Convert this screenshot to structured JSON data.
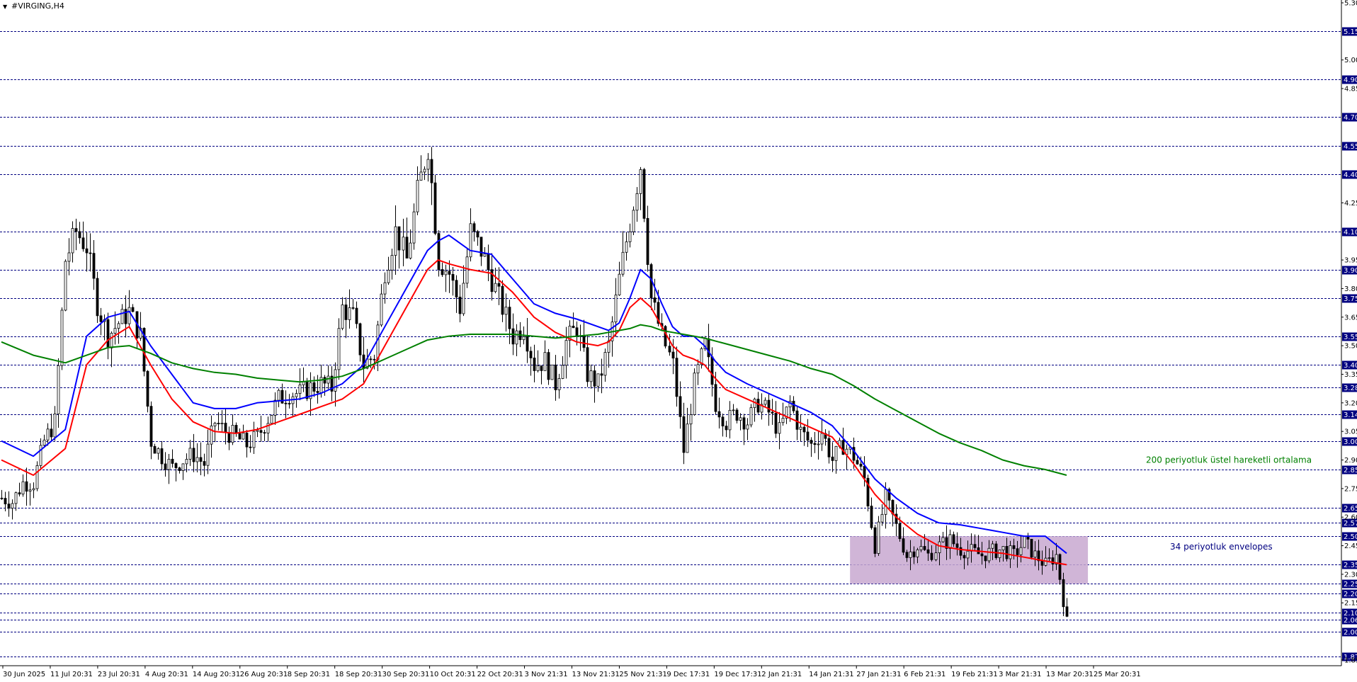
{
  "window": {
    "symbol_title": "#VIRGING,H4",
    "menu_glyph": "▼"
  },
  "colors": {
    "ema_blue": "#0000ff",
    "ema_red": "#ff0000",
    "ema_green": "#008000",
    "candle": "#000000",
    "price_tag_bg": "#000080",
    "hline": "#000080",
    "envelope_box": "#c8a8d0"
  },
  "chart_data": {
    "type": "candlestick",
    "symbol": "#VIRGING,H4",
    "ylim": [
      1.82,
      5.3
    ],
    "y_ticks": [
      "5.30",
      "5.00",
      "4.85",
      "4.25",
      "3.95",
      "3.80",
      "3.65",
      "3.50",
      "3.35",
      "3.20",
      "3.05",
      "2.90",
      "2.75",
      "2.60",
      "2.45",
      "2.30",
      "2.15",
      "1.85"
    ],
    "price_lines": [
      "5.15",
      "4.90",
      "4.70",
      "4.55",
      "4.40",
      "4.10",
      "3.90",
      "3.75",
      "3.55",
      "3.40",
      "3.28",
      "3.14",
      "3.00",
      "2.85",
      "2.65",
      "2.57",
      "2.50",
      "2.35",
      "2.25",
      "2.20",
      "2.10",
      "2.06",
      "2.00",
      "1.87"
    ],
    "x_labels": [
      "30 Jun 2025",
      "11 Jul 20:31",
      "23 Jul 20:31",
      "4 Aug 20:31",
      "14 Aug 20:31",
      "26 Aug 20:31",
      "8 Sep 20:31",
      "18 Sep 20:31",
      "30 Sep 20:31",
      "10 Oct 20:31",
      "22 Oct 20:31",
      "3 Nov 21:31",
      "13 Nov 21:31",
      "25 Nov 21:31",
      "9 Dec 17:31",
      "19 Dec 17:31",
      "2 Jan 21:31",
      "14 Jan 21:31",
      "27 Jan 21:31",
      "6 Feb 21:31",
      "19 Feb 21:31",
      "3 Mar 21:31",
      "13 Mar 20:31",
      "25 Mar 20:31"
    ],
    "price_path": [
      [
        0,
        2.7
      ],
      [
        15,
        2.68
      ],
      [
        30,
        2.78
      ],
      [
        45,
        2.78
      ],
      [
        60,
        3.0
      ],
      [
        75,
        3.1
      ],
      [
        90,
        3.95
      ],
      [
        105,
        4.1
      ],
      [
        120,
        4.02
      ],
      [
        135,
        3.72
      ],
      [
        150,
        3.55
      ],
      [
        165,
        3.62
      ],
      [
        180,
        3.68
      ],
      [
        195,
        3.55
      ],
      [
        210,
        3.0
      ],
      [
        225,
        2.92
      ],
      [
        240,
        2.86
      ],
      [
        255,
        2.9
      ],
      [
        270,
        2.93
      ],
      [
        285,
        2.88
      ],
      [
        300,
        3.1
      ],
      [
        315,
        3.05
      ],
      [
        330,
        3.02
      ],
      [
        345,
        2.98
      ],
      [
        360,
        3.02
      ],
      [
        375,
        3.12
      ],
      [
        390,
        3.22
      ],
      [
        405,
        3.25
      ],
      [
        420,
        3.25
      ],
      [
        435,
        3.28
      ],
      [
        450,
        3.3
      ],
      [
        465,
        3.28
      ],
      [
        480,
        3.7
      ],
      [
        495,
        3.65
      ],
      [
        510,
        3.4
      ],
      [
        525,
        3.45
      ],
      [
        540,
        3.9
      ],
      [
        555,
        4.1
      ],
      [
        570,
        3.95
      ],
      [
        585,
        4.3
      ],
      [
        600,
        4.55
      ],
      [
        615,
        3.95
      ],
      [
        630,
        3.88
      ],
      [
        645,
        3.7
      ],
      [
        660,
        4.1
      ],
      [
        675,
        4.0
      ],
      [
        690,
        3.85
      ],
      [
        705,
        3.7
      ],
      [
        720,
        3.55
      ],
      [
        735,
        3.6
      ],
      [
        750,
        3.4
      ],
      [
        765,
        3.42
      ],
      [
        780,
        3.3
      ],
      [
        795,
        3.52
      ],
      [
        810,
        3.6
      ],
      [
        825,
        3.35
      ],
      [
        840,
        3.3
      ],
      [
        855,
        3.5
      ],
      [
        870,
        3.85
      ],
      [
        885,
        4.15
      ],
      [
        900,
        4.45
      ],
      [
        915,
        3.75
      ],
      [
        930,
        3.55
      ],
      [
        945,
        3.4
      ],
      [
        960,
        2.95
      ],
      [
        975,
        3.3
      ],
      [
        990,
        3.5
      ],
      [
        1005,
        3.2
      ],
      [
        1020,
        3.1
      ],
      [
        1035,
        3.15
      ],
      [
        1050,
        3.1
      ],
      [
        1065,
        3.2
      ],
      [
        1080,
        3.15
      ],
      [
        1095,
        3.05
      ],
      [
        1110,
        3.2
      ],
      [
        1125,
        3.05
      ],
      [
        1140,
        2.98
      ],
      [
        1155,
        3.05
      ],
      [
        1170,
        2.9
      ],
      [
        1185,
        2.98
      ],
      [
        1200,
        2.92
      ],
      [
        1215,
        2.8
      ],
      [
        1230,
        2.45
      ],
      [
        1245,
        2.7
      ],
      [
        1260,
        2.55
      ],
      [
        1275,
        2.4
      ],
      [
        1290,
        2.45
      ],
      [
        1305,
        2.4
      ],
      [
        1320,
        2.45
      ],
      [
        1335,
        2.48
      ],
      [
        1350,
        2.43
      ],
      [
        1365,
        2.42
      ],
      [
        1380,
        2.4
      ],
      [
        1395,
        2.42
      ],
      [
        1410,
        2.43
      ],
      [
        1425,
        2.4
      ],
      [
        1440,
        2.47
      ],
      [
        1455,
        2.4
      ],
      [
        1470,
        2.35
      ],
      [
        1485,
        2.4
      ],
      [
        1500,
        2.05
      ]
    ],
    "series": [
      {
        "name": "",
        "color": "#0000ff",
        "type": "ema",
        "points": [
          [
            0,
            3.0
          ],
          [
            45,
            2.92
          ],
          [
            90,
            3.06
          ],
          [
            120,
            3.55
          ],
          [
            150,
            3.65
          ],
          [
            180,
            3.68
          ],
          [
            210,
            3.5
          ],
          [
            240,
            3.35
          ],
          [
            270,
            3.2
          ],
          [
            300,
            3.17
          ],
          [
            330,
            3.17
          ],
          [
            360,
            3.2
          ],
          [
            390,
            3.21
          ],
          [
            420,
            3.22
          ],
          [
            450,
            3.25
          ],
          [
            480,
            3.3
          ],
          [
            510,
            3.4
          ],
          [
            540,
            3.6
          ],
          [
            570,
            3.8
          ],
          [
            600,
            4.0
          ],
          [
            615,
            4.05
          ],
          [
            630,
            4.08
          ],
          [
            660,
            4.0
          ],
          [
            690,
            3.98
          ],
          [
            720,
            3.85
          ],
          [
            750,
            3.72
          ],
          [
            780,
            3.67
          ],
          [
            810,
            3.64
          ],
          [
            840,
            3.6
          ],
          [
            855,
            3.58
          ],
          [
            870,
            3.62
          ],
          [
            885,
            3.75
          ],
          [
            900,
            3.9
          ],
          [
            915,
            3.85
          ],
          [
            930,
            3.72
          ],
          [
            945,
            3.6
          ],
          [
            960,
            3.55
          ],
          [
            975,
            3.55
          ],
          [
            990,
            3.5
          ],
          [
            1005,
            3.42
          ],
          [
            1020,
            3.36
          ],
          [
            1050,
            3.3
          ],
          [
            1080,
            3.25
          ],
          [
            1110,
            3.2
          ],
          [
            1140,
            3.15
          ],
          [
            1170,
            3.08
          ],
          [
            1200,
            2.95
          ],
          [
            1230,
            2.8
          ],
          [
            1260,
            2.7
          ],
          [
            1290,
            2.62
          ],
          [
            1320,
            2.57
          ],
          [
            1350,
            2.56
          ],
          [
            1380,
            2.54
          ],
          [
            1410,
            2.52
          ],
          [
            1440,
            2.5
          ],
          [
            1470,
            2.5
          ],
          [
            1500,
            2.41
          ]
        ]
      },
      {
        "name": "",
        "color": "#ff0000",
        "type": "ema",
        "points": [
          [
            0,
            2.9
          ],
          [
            45,
            2.82
          ],
          [
            90,
            2.96
          ],
          [
            120,
            3.4
          ],
          [
            150,
            3.53
          ],
          [
            180,
            3.6
          ],
          [
            210,
            3.4
          ],
          [
            240,
            3.22
          ],
          [
            270,
            3.1
          ],
          [
            300,
            3.05
          ],
          [
            330,
            3.04
          ],
          [
            360,
            3.06
          ],
          [
            390,
            3.1
          ],
          [
            420,
            3.14
          ],
          [
            450,
            3.18
          ],
          [
            480,
            3.22
          ],
          [
            510,
            3.3
          ],
          [
            540,
            3.5
          ],
          [
            570,
            3.7
          ],
          [
            600,
            3.9
          ],
          [
            615,
            3.95
          ],
          [
            630,
            3.93
          ],
          [
            660,
            3.9
          ],
          [
            690,
            3.88
          ],
          [
            720,
            3.78
          ],
          [
            750,
            3.65
          ],
          [
            780,
            3.57
          ],
          [
            810,
            3.52
          ],
          [
            840,
            3.5
          ],
          [
            855,
            3.52
          ],
          [
            870,
            3.58
          ],
          [
            885,
            3.7
          ],
          [
            900,
            3.75
          ],
          [
            915,
            3.7
          ],
          [
            930,
            3.6
          ],
          [
            945,
            3.5
          ],
          [
            960,
            3.45
          ],
          [
            975,
            3.43
          ],
          [
            990,
            3.4
          ],
          [
            1005,
            3.33
          ],
          [
            1020,
            3.27
          ],
          [
            1050,
            3.22
          ],
          [
            1080,
            3.17
          ],
          [
            1110,
            3.12
          ],
          [
            1140,
            3.07
          ],
          [
            1170,
            3.02
          ],
          [
            1200,
            2.88
          ],
          [
            1230,
            2.72
          ],
          [
            1260,
            2.6
          ],
          [
            1290,
            2.51
          ],
          [
            1320,
            2.45
          ],
          [
            1350,
            2.43
          ],
          [
            1380,
            2.42
          ],
          [
            1410,
            2.41
          ],
          [
            1440,
            2.39
          ],
          [
            1470,
            2.37
          ],
          [
            1500,
            2.35
          ]
        ]
      },
      {
        "name": "200 periyotluk üstel hareketli ortalama",
        "color": "#008000",
        "type": "ema",
        "points": [
          [
            0,
            3.52
          ],
          [
            45,
            3.45
          ],
          [
            90,
            3.41
          ],
          [
            120,
            3.45
          ],
          [
            150,
            3.49
          ],
          [
            180,
            3.5
          ],
          [
            210,
            3.46
          ],
          [
            240,
            3.41
          ],
          [
            270,
            3.38
          ],
          [
            300,
            3.36
          ],
          [
            330,
            3.35
          ],
          [
            360,
            3.33
          ],
          [
            390,
            3.32
          ],
          [
            420,
            3.31
          ],
          [
            450,
            3.32
          ],
          [
            480,
            3.34
          ],
          [
            510,
            3.38
          ],
          [
            540,
            3.43
          ],
          [
            570,
            3.48
          ],
          [
            600,
            3.53
          ],
          [
            630,
            3.55
          ],
          [
            660,
            3.56
          ],
          [
            690,
            3.56
          ],
          [
            720,
            3.56
          ],
          [
            750,
            3.55
          ],
          [
            780,
            3.54
          ],
          [
            810,
            3.55
          ],
          [
            840,
            3.56
          ],
          [
            855,
            3.57
          ],
          [
            870,
            3.58
          ],
          [
            885,
            3.59
          ],
          [
            900,
            3.61
          ],
          [
            915,
            3.6
          ],
          [
            930,
            3.58
          ],
          [
            945,
            3.57
          ],
          [
            960,
            3.56
          ],
          [
            990,
            3.54
          ],
          [
            1020,
            3.51
          ],
          [
            1050,
            3.48
          ],
          [
            1080,
            3.45
          ],
          [
            1110,
            3.42
          ],
          [
            1140,
            3.38
          ],
          [
            1170,
            3.35
          ],
          [
            1200,
            3.29
          ],
          [
            1230,
            3.22
          ],
          [
            1260,
            3.16
          ],
          [
            1290,
            3.1
          ],
          [
            1320,
            3.04
          ],
          [
            1350,
            2.99
          ],
          [
            1380,
            2.95
          ],
          [
            1410,
            2.9
          ],
          [
            1440,
            2.87
          ],
          [
            1470,
            2.85
          ],
          [
            1500,
            2.82
          ]
        ]
      }
    ],
    "envelope_zone": {
      "x_range": [
        1195,
        1530
      ],
      "price_range": [
        2.25,
        2.5
      ],
      "label": "34 periyotluk envelopes"
    },
    "annotations": [
      {
        "text": "200 periyotluk üstel hareketli ortalama",
        "color": "#008000",
        "anchor_x": 1618,
        "anchor_price": 2.9
      },
      {
        "text": "34 periyotluk envelopes",
        "color": "#000080",
        "anchor_x": 1652,
        "anchor_price": 2.445
      }
    ]
  }
}
